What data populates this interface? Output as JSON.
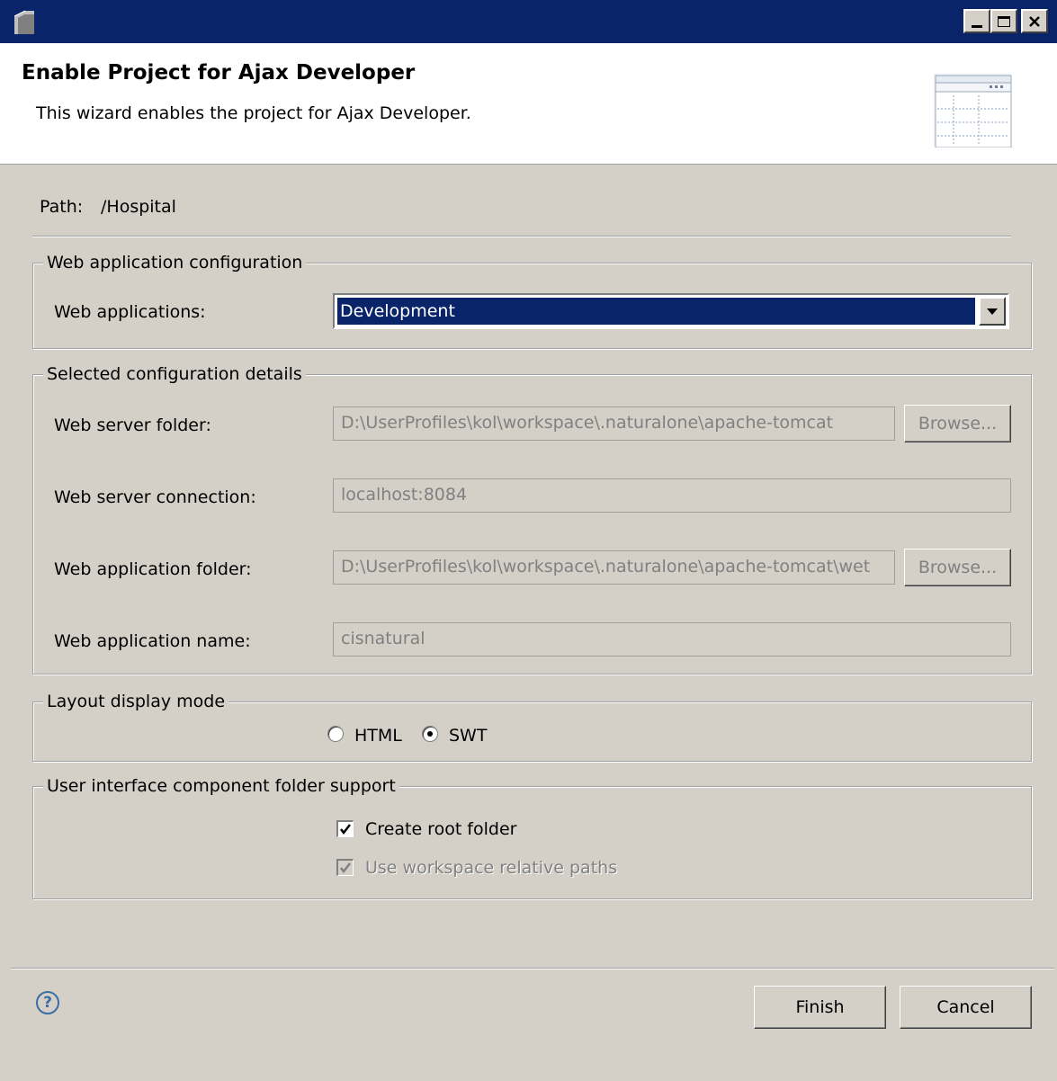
{
  "window": {
    "title": "",
    "controls": {
      "minimize": "_",
      "maximize": "□",
      "close": "×"
    }
  },
  "header": {
    "title": "Enable Project for Ajax Developer",
    "description": "This wizard enables the project for Ajax Developer."
  },
  "path": {
    "label": "Path:",
    "value": "/Hospital"
  },
  "web_app_config": {
    "legend": "Web application configuration",
    "label": "Web applications:",
    "selected": "Development"
  },
  "config_details": {
    "legend": "Selected configuration details",
    "server_folder": {
      "label": "Web server folder:",
      "value": "D:\\UserProfiles\\kol\\workspace\\.naturalone\\apache-tomcat",
      "browse": "Browse..."
    },
    "server_connection": {
      "label": "Web server connection:",
      "value": "localhost:8084"
    },
    "app_folder": {
      "label": "Web application folder:",
      "value": "D:\\UserProfiles\\kol\\workspace\\.naturalone\\apache-tomcat\\wet",
      "browse": "Browse..."
    },
    "app_name": {
      "label": "Web application name:",
      "value": "cisnatural"
    }
  },
  "layout_mode": {
    "legend": "Layout display mode",
    "options": [
      {
        "label": "HTML",
        "selected": false
      },
      {
        "label": "SWT",
        "selected": true
      }
    ]
  },
  "ui_component": {
    "legend": "User interface component folder support",
    "create_root": {
      "label": "Create root folder",
      "checked": true,
      "enabled": true
    },
    "workspace_relative": {
      "label": "Use workspace relative paths",
      "checked": true,
      "enabled": false
    }
  },
  "footer": {
    "help": "?",
    "finish": "Finish",
    "cancel": "Cancel"
  },
  "colors": {
    "titlebar": "#0a246a",
    "dialog_bg": "#d4d0c8",
    "header_bg": "#ffffff",
    "selection": "#0a246a",
    "disabled_text": "#808080"
  }
}
